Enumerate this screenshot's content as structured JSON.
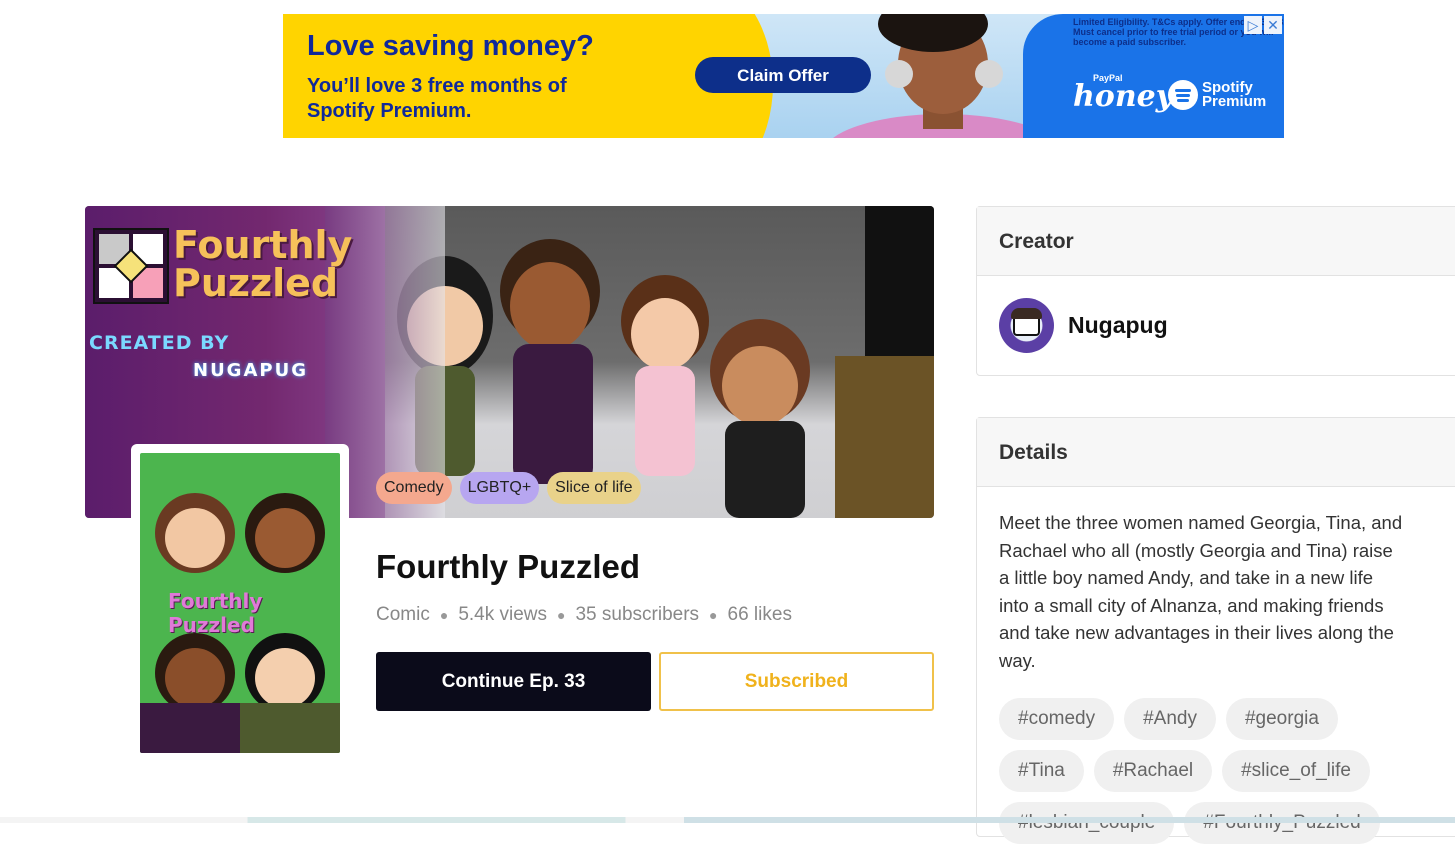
{
  "ad": {
    "headline": "Love saving money?",
    "subline": "You’ll love 3 free months of Spotify Premium.",
    "cta": "Claim Offer",
    "fineprint": "Limited Eligibility. T&Cs apply. Offer ends 9/30/23. Must cancel prior to free trial period or you will become a paid subscriber.",
    "brand_paypal": "PayPal",
    "brand_honey": "honey",
    "brand_spotify": "Spotify Premium",
    "adchoices_icon": "adchoices-icon",
    "close_icon": "close-icon",
    "colors": {
      "yellow": "#ffd400",
      "navy": "#0d2f8a",
      "blue": "#1a73e8"
    }
  },
  "hero": {
    "logo_text": "Fourthly\nPuzzled",
    "created_by": "CREATED BY",
    "author_mark": "NUGAPUG",
    "genres": [
      {
        "label": "Comedy",
        "color": "#f4a88e"
      },
      {
        "label": "LGBTQ+",
        "color": "#b7a6f0"
      },
      {
        "label": "Slice of life",
        "color": "#e9d28a"
      }
    ]
  },
  "cover": {
    "title": "Fourthly Puzzled"
  },
  "comic": {
    "title": "Fourthly Puzzled",
    "type": "Comic",
    "views": "5.4k views",
    "subscribers": "35 subscribers",
    "likes": "66 likes",
    "continue_label": "Continue Ep. 33",
    "subscribe_label": "Subscribed"
  },
  "creator": {
    "heading": "Creator",
    "name": "Nugapug"
  },
  "details": {
    "heading": "Details",
    "description": "Meet the three women named Georgia, Tina, and Rachael who all (mostly Georgia and Tina) raise a little boy named Andy, and take in a new life into a small city of Alnanza, and making friends and take new advantages in their lives along the way.",
    "hashtags": [
      "#comedy",
      "#Andy",
      "#georgia",
      "#Tina",
      "#Rachael",
      "#slice_of_life",
      "#lesbian_couple",
      "#Fourthly_Puzzled"
    ]
  }
}
